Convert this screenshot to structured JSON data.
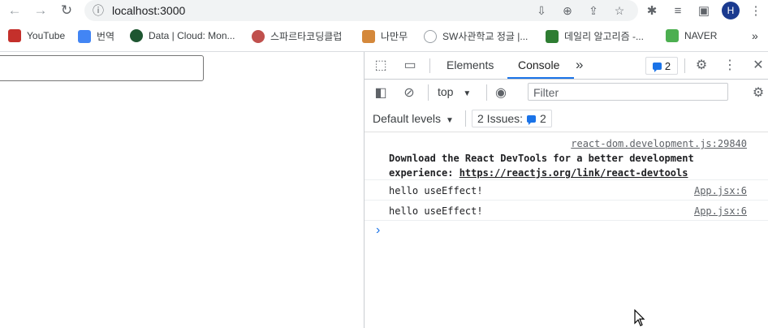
{
  "browser": {
    "url": "localhost:3000",
    "profile_initial": "H",
    "bookmarks": [
      {
        "label": "YouTube",
        "color": "#c4302b"
      },
      {
        "label": "번역",
        "color": "#4285f4"
      },
      {
        "label": "Data | Cloud: Mon...",
        "color": "#1e5631"
      },
      {
        "label": "스파르타코딩클럽",
        "color": "#c0504d"
      },
      {
        "label": "나만무",
        "color": "#d4883b"
      },
      {
        "label": "SW사관학교 정글 |...",
        "color": "#9aa0a6"
      },
      {
        "label": "데일리 알고리즘 -...",
        "color": "#2e7d32"
      },
      {
        "label": "NAVER",
        "color": "#4caf50"
      }
    ],
    "more_label": "»"
  },
  "devtools": {
    "tabs": [
      "Elements",
      "Console"
    ],
    "active_tab": "Console",
    "more_tabs": "»",
    "issues_badge_count": "2",
    "context": "top",
    "filter_placeholder": "Filter",
    "levels_label": "Default levels",
    "issues_label": "2 Issues:",
    "issues_count": "2",
    "messages": [
      {
        "source": "react-dom.development.js:29840",
        "line1": "Download the React DevTools for a better development",
        "line2_prefix": "experience: ",
        "link": "https://reactjs.org/link/react-devtools"
      },
      {
        "text": "hello useEffect!",
        "source": "App.jsx:6"
      },
      {
        "text": "hello useEffect!",
        "source": "App.jsx:6"
      }
    ],
    "prompt": "›"
  },
  "colors": {
    "accent": "#1a73e8",
    "profile": "#1a3a8f"
  }
}
